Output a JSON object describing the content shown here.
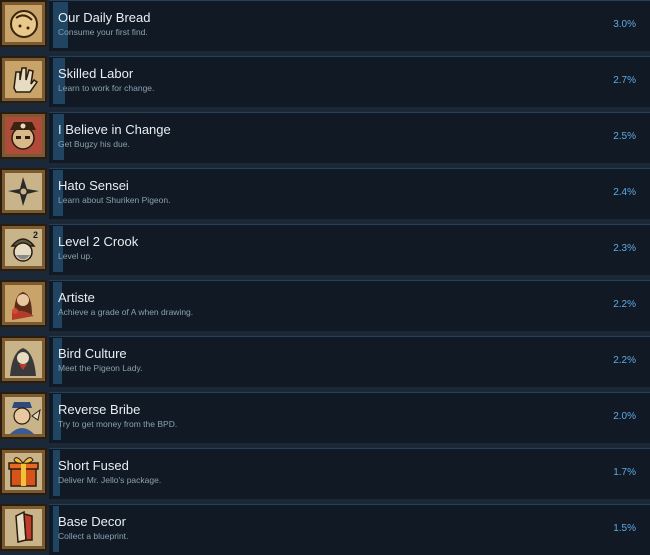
{
  "achievements": [
    {
      "title": "Our Daily Bread",
      "desc": "Consume your first find.",
      "pct": "3.0%",
      "percent_value": 3.0,
      "icon": "bread-icon"
    },
    {
      "title": "Skilled Labor",
      "desc": "Learn to work for change.",
      "pct": "2.7%",
      "percent_value": 2.7,
      "icon": "hand-icon"
    },
    {
      "title": "I Believe in Change",
      "desc": "Get Bugzy his due.",
      "pct": "2.5%",
      "percent_value": 2.5,
      "icon": "pirate-icon"
    },
    {
      "title": "Hato Sensei",
      "desc": "Learn about Shuriken Pigeon.",
      "pct": "2.4%",
      "percent_value": 2.4,
      "icon": "shuriken-icon"
    },
    {
      "title": "Level 2 Crook",
      "desc": "Level up.",
      "pct": "2.3%",
      "percent_value": 2.3,
      "icon": "crook-icon",
      "icon_text": "2"
    },
    {
      "title": "Artiste",
      "desc": "Achieve a grade of A when drawing.",
      "pct": "2.2%",
      "percent_value": 2.2,
      "icon": "artist-icon"
    },
    {
      "title": "Bird Culture",
      "desc": "Meet the Pigeon Lady.",
      "pct": "2.2%",
      "percent_value": 2.2,
      "icon": "pigeon-icon"
    },
    {
      "title": "Reverse Bribe",
      "desc": "Try to get money from the BPD.",
      "pct": "2.0%",
      "percent_value": 2.0,
      "icon": "police-icon"
    },
    {
      "title": "Short Fused",
      "desc": "Deliver Mr. Jello's package.",
      "pct": "1.7%",
      "percent_value": 1.7,
      "icon": "gift-icon"
    },
    {
      "title": "Base Decor",
      "desc": "Collect a blueprint.",
      "pct": "1.5%",
      "percent_value": 1.5,
      "icon": "blueprint-icon"
    }
  ]
}
